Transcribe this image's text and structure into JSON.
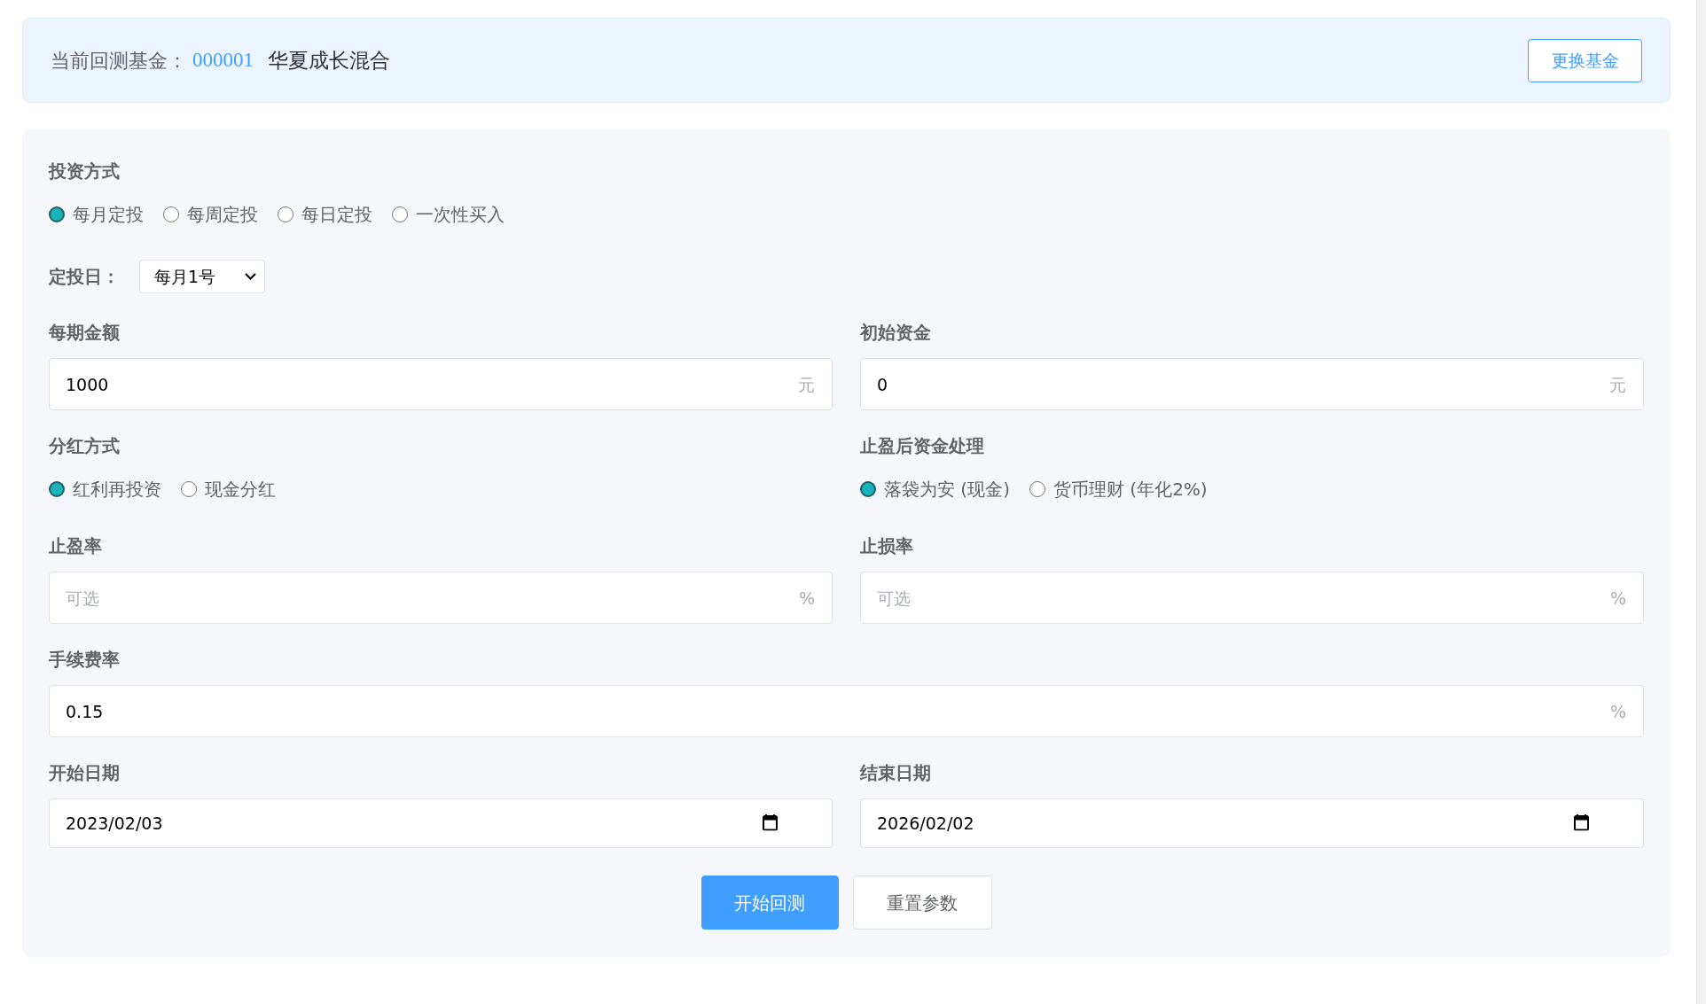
{
  "fund_banner": {
    "label": "当前回测基金：",
    "code": "000001",
    "name": "华夏成长混合",
    "button": "更换基金"
  },
  "form": {
    "rows": [
      [
        {
          "kind": "radio_group",
          "label": "投资方式",
          "options": [
            {
              "label": "每月定投",
              "selected": true
            },
            {
              "label": "每周定投",
              "selected": false
            },
            {
              "label": "每日定投",
              "selected": false
            },
            {
              "label": "一次性买入",
              "selected": false
            }
          ]
        }
      ],
      [
        {
          "kind": "select",
          "label": "定投日：",
          "value": "每月1号"
        }
      ],
      [
        {
          "kind": "input",
          "label": "每期金额",
          "value": "1000",
          "unit": "元"
        },
        {
          "kind": "input",
          "label": "初始资金",
          "value": "0",
          "unit": "元"
        }
      ],
      [
        {
          "kind": "radio_group",
          "label": "分红方式",
          "options": [
            {
              "label": "红利再投资",
              "selected": true
            },
            {
              "label": "现金分红",
              "selected": false
            }
          ]
        },
        {
          "kind": "radio_group",
          "label": "止盈后资金处理",
          "options": [
            {
              "label": "落袋为安 (现金)",
              "selected": true
            },
            {
              "label": "货币理财 (年化2%)",
              "selected": false
            }
          ]
        }
      ],
      [
        {
          "kind": "input",
          "label": "止盈率",
          "placeholder": "可选",
          "unit": "%"
        },
        {
          "kind": "input",
          "label": "止损率",
          "placeholder": "可选",
          "unit": "%"
        }
      ],
      [
        {
          "kind": "input",
          "label": "手续费率",
          "value": "0.15",
          "unit": "%"
        }
      ],
      [
        {
          "kind": "date",
          "label": "开始日期",
          "value": "2023/02/03"
        },
        {
          "kind": "date",
          "label": "结束日期",
          "value": "2026/02/02"
        }
      ]
    ],
    "buttons": [
      {
        "kind": "primary",
        "label": "开始回测"
      },
      {
        "kind": "default",
        "label": "重置参数"
      }
    ]
  }
}
